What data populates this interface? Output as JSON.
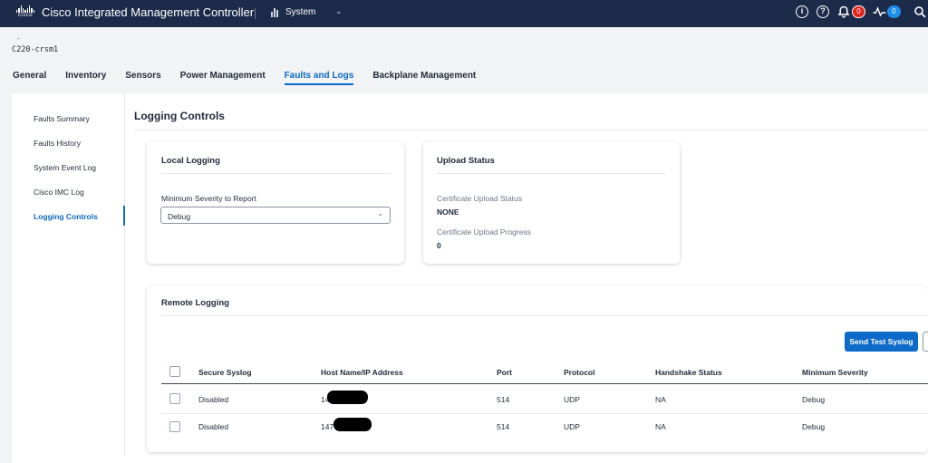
{
  "header": {
    "logo_text": "cisco",
    "app_title": "Cisco Integrated Management Controller",
    "system_switcher": "System",
    "alerts_count": "0",
    "activity_count": "0",
    "info_icon": "info-icon",
    "help_icon": "help-icon",
    "bell_icon": "bell-icon",
    "activity_icon": "activity-icon",
    "user_icon": "user-icon"
  },
  "server": {
    "dash": "-",
    "name": "C220-crsm1"
  },
  "tabs": [
    {
      "label": "General"
    },
    {
      "label": "Inventory"
    },
    {
      "label": "Sensors"
    },
    {
      "label": "Power Management"
    },
    {
      "label": "Faults and Logs",
      "active": true
    },
    {
      "label": "Backplane Management"
    }
  ],
  "sidenav": [
    {
      "label": "Faults Summary"
    },
    {
      "label": "Faults History"
    },
    {
      "label": "System Event Log"
    },
    {
      "label": "Cisco IMC Log"
    },
    {
      "label": "Logging Controls",
      "active": true
    }
  ],
  "page_title": "Logging Controls",
  "local_logging": {
    "title": "Local Logging",
    "severity_label": "Minimum Severity to Report",
    "severity_value": "Debug"
  },
  "upload_status": {
    "title": "Upload Status",
    "cert_status_label": "Certificate Upload Status",
    "cert_status_value": "NONE",
    "cert_progress_label": "Certificate Upload Progress",
    "cert_progress_value": "0"
  },
  "remote_logging": {
    "title": "Remote Logging",
    "send_test_label": "Send Test Syslog",
    "columns": [
      "Secure Syslog",
      "Host Name/IP Address",
      "Port",
      "Protocol",
      "Handshake Status",
      "Minimum Severity"
    ],
    "rows": [
      {
        "secure": "Disabled",
        "host": "14",
        "port": "514",
        "protocol": "UDP",
        "handshake": "NA",
        "severity": "Debug"
      },
      {
        "secure": "Disabled",
        "host": "147",
        "port": "514",
        "protocol": "UDP",
        "handshake": "NA",
        "severity": "Debug"
      }
    ]
  },
  "colors": {
    "topbar": "#1c2b4a",
    "accent": "#0d6ac9",
    "alert_badge": "#e3241b",
    "activity_badge": "#1e8ee8"
  }
}
